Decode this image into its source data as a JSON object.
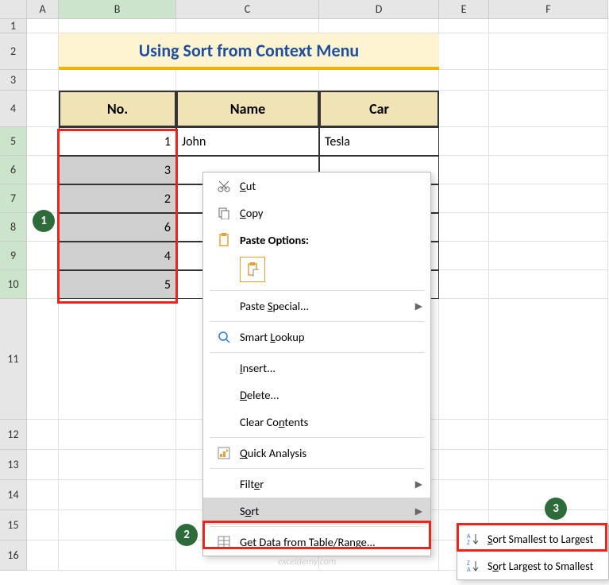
{
  "columns": [
    "A",
    "B",
    "C",
    "D",
    "E",
    "F"
  ],
  "rows": [
    "1",
    "2",
    "3",
    "4",
    "5",
    "6",
    "7",
    "8",
    "9",
    "10",
    "11",
    "12",
    "13",
    "14",
    "15",
    "16"
  ],
  "title": "Using Sort from Context Menu",
  "headers": {
    "b": "No.",
    "c": "Name",
    "d": "Car"
  },
  "data": {
    "r5": {
      "no": "1",
      "name": "John",
      "car": "Tesla"
    },
    "r6": {
      "no": "3"
    },
    "r7": {
      "no": "2"
    },
    "r8": {
      "no": "6"
    },
    "r9": {
      "no": "4"
    },
    "r10": {
      "no": "5"
    }
  },
  "ctx": {
    "cut": "Cut",
    "copy": "Copy",
    "paste_options": "Paste Options:",
    "paste_special": "Paste Special...",
    "smart_lookup": "Smart Lookup",
    "insert": "Insert...",
    "delete": "Delete...",
    "clear": "Clear Contents",
    "quick": "Quick Analysis",
    "filter": "Filter",
    "sort": "Sort",
    "getdata": "Get Data from Table/Range..."
  },
  "sub": {
    "asc": "Sort Smallest to Largest",
    "desc": "Sort Largest to Smallest"
  },
  "badges": {
    "b1": "1",
    "b2": "2",
    "b3": "3"
  },
  "watermark": "exceldemy.com",
  "chart_data": null
}
